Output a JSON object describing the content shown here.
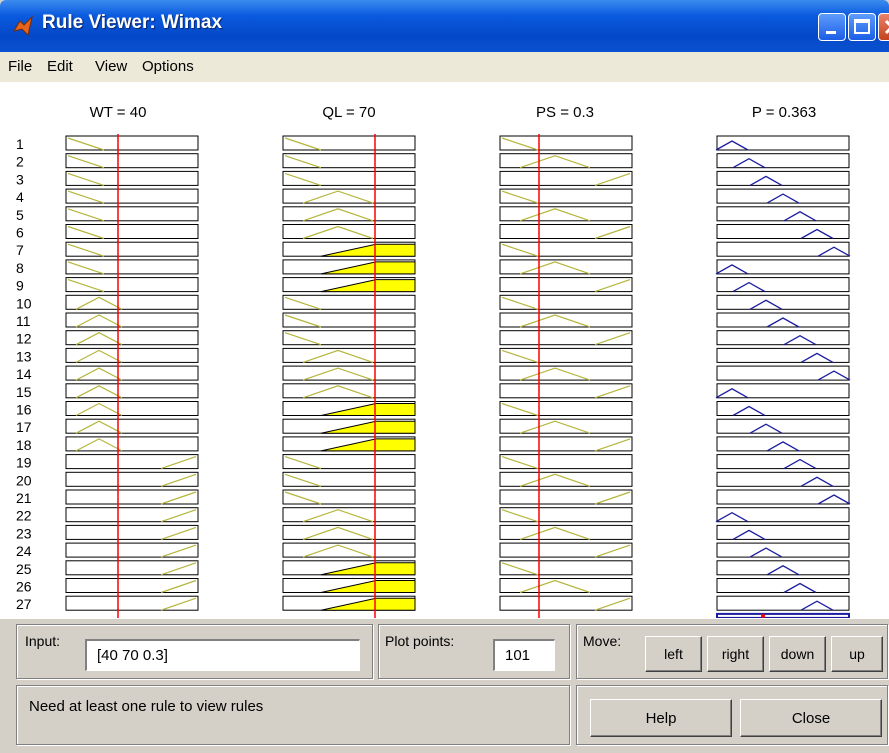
{
  "window": {
    "title": "Rule Viewer: Wimax",
    "menu": [
      "File",
      "Edit",
      "View",
      "Options"
    ]
  },
  "plots": {
    "headers": [
      "WT = 40",
      "QL = 70",
      "PS = 0.3",
      "P = 0.363"
    ],
    "rule_numbers": [
      "1",
      "2",
      "3",
      "4",
      "5",
      "6",
      "7",
      "8",
      "9",
      "10",
      "11",
      "12",
      "13",
      "14",
      "15",
      "16",
      "17",
      "18",
      "19",
      "20",
      "21",
      "22",
      "23",
      "24",
      "25",
      "26",
      "27"
    ],
    "colors": {
      "input_curve": "#b5b53c",
      "input_fill": "#ffff00",
      "output_curve": "#1c1ca0",
      "indicator": "#ff0000",
      "box_border": "#000000"
    }
  },
  "controls": {
    "input_label": "Input:",
    "input_value": "[40 70 0.3]",
    "plot_points_label": "Plot points:",
    "plot_points_value": "101",
    "move_label": "Move:",
    "move_buttons": [
      "left",
      "right",
      "down",
      "up"
    ],
    "status": "Need at least one rule to view rules",
    "help_label": "Help",
    "close_label": "Close"
  }
}
